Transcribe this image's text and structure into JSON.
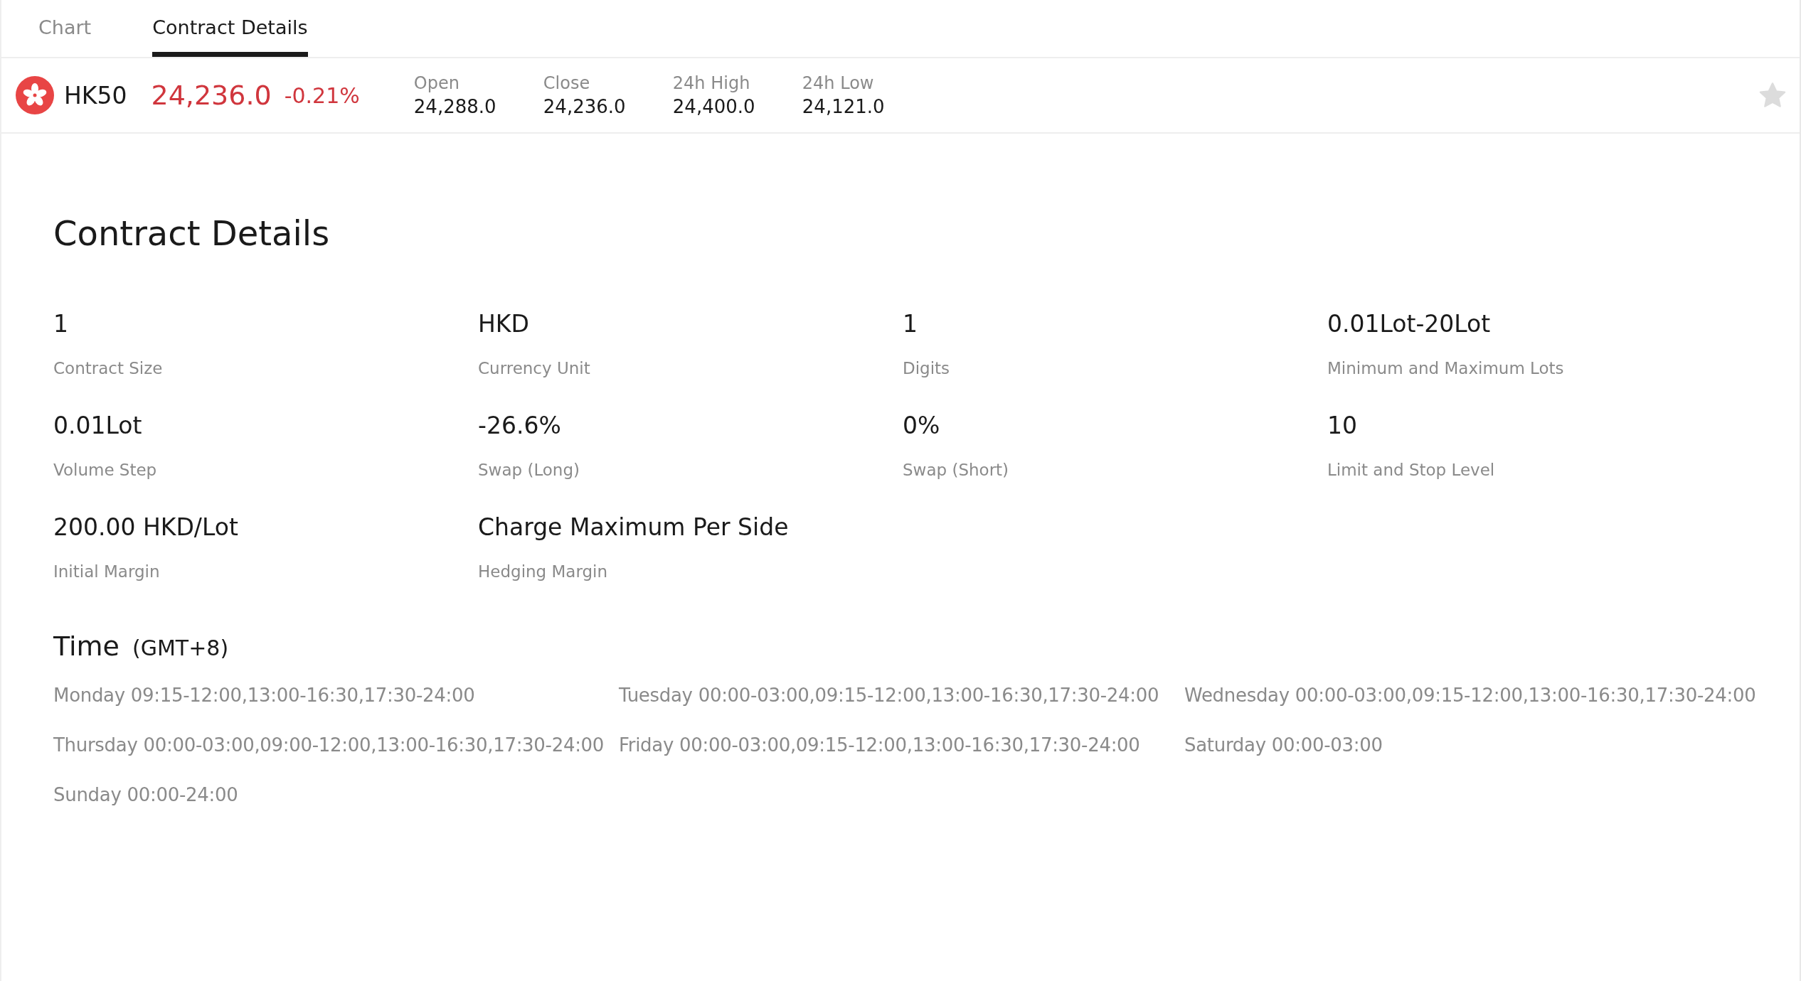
{
  "tabs": [
    {
      "label": "Chart",
      "selected": false
    },
    {
      "label": "Contract Details",
      "selected": true
    }
  ],
  "quote": {
    "symbol": "HK50",
    "price": "24,236.0",
    "change": "-0.21%",
    "favorite": false,
    "stats": [
      {
        "label": "Open",
        "value": "24,288.0"
      },
      {
        "label": "Close",
        "value": "24,236.0"
      },
      {
        "label": "24h High",
        "value": "24,400.0"
      },
      {
        "label": "24h Low",
        "value": "24,121.0"
      }
    ]
  },
  "contract": {
    "title": "Contract Details",
    "specs": [
      {
        "value": "1",
        "label": "Contract Size"
      },
      {
        "value": "HKD",
        "label": "Currency Unit"
      },
      {
        "value": "1",
        "label": "Digits"
      },
      {
        "value": "0.01Lot-20Lot",
        "label": "Minimum and Maximum Lots"
      },
      {
        "value": "0.01Lot",
        "label": "Volume Step"
      },
      {
        "value": "-26.6%",
        "label": "Swap (Long)"
      },
      {
        "value": "0%",
        "label": "Swap (Short)"
      },
      {
        "value": "10",
        "label": "Limit and Stop Level"
      },
      {
        "value": "200.00 HKD/Lot",
        "label": "Initial Margin"
      },
      {
        "value": "Charge Maximum Per Side",
        "label": "Hedging Margin"
      }
    ]
  },
  "time": {
    "title": "Time",
    "timezone": "(GMT+8)",
    "sessions": [
      "Monday 09:15-12:00,13:00-16:30,17:30-24:00",
      "Tuesday 00:00-03:00,09:15-12:00,13:00-16:30,17:30-24:00",
      "Wednesday 00:00-03:00,09:15-12:00,13:00-16:30,17:30-24:00",
      "Thursday 00:00-03:00,09:00-12:00,13:00-16:30,17:30-24:00",
      "Friday 00:00-03:00,09:15-12:00,13:00-16:30,17:30-24:00",
      "Saturday 00:00-03:00",
      "Sunday 00:00-24:00"
    ]
  }
}
